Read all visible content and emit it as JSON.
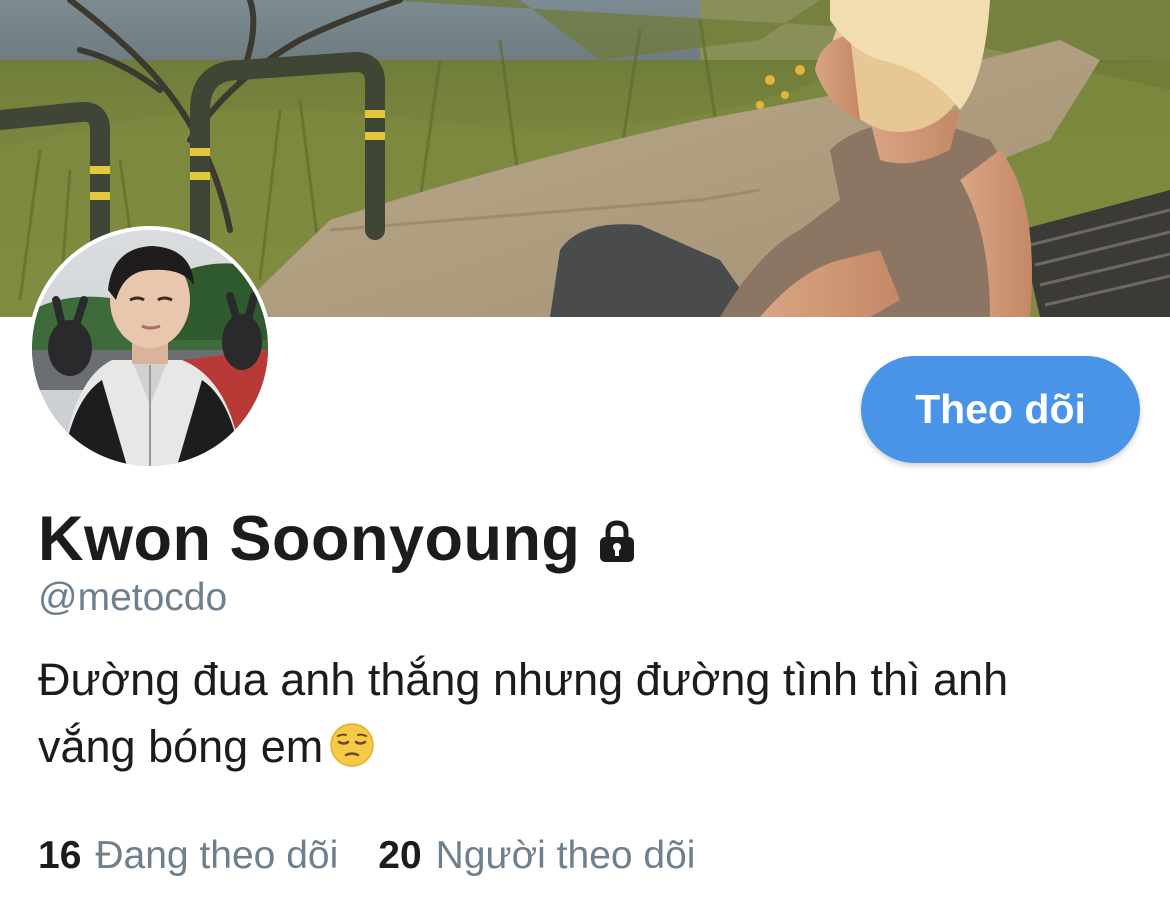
{
  "profile": {
    "display_name": "Kwon Soonyoung",
    "handle": "@metocdo",
    "bio_line1": "Đường đua anh thắng nhưng đường tình thì anh",
    "bio_line2": "vắng bóng em",
    "bio_emoji": "pensive-face-icon",
    "protected": true
  },
  "actions": {
    "follow_label": "Theo dõi"
  },
  "stats": {
    "following_count": "16",
    "following_label": "Đang theo dõi",
    "followers_count": "20",
    "followers_label": "Người theo dõi"
  },
  "colors": {
    "accent": "#4a94e8",
    "secondary_text": "#6e7f8e",
    "primary_text": "#1c1c1e"
  }
}
